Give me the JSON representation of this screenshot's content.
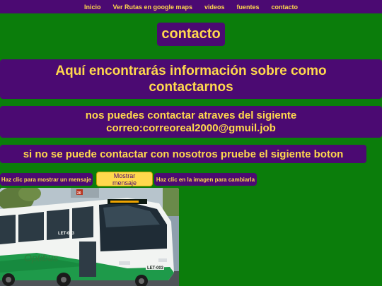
{
  "nav": {
    "items": [
      "Inicio",
      "Ver Rutas en google maps",
      "videos",
      "fuentes",
      "contacto"
    ]
  },
  "page": {
    "title": "contacto",
    "info": "Aquí encontrarás información sobre como contactarnos",
    "contact_line1": "nos puedes contactar atraves del sigiente",
    "contact_line2": "correo:correoreal2000@gmuil.job",
    "fallback": "si no se puede contactar con nosotros pruebe el sigiente boton"
  },
  "controls": {
    "message_label": "Haz clic para mostrar un mensaje",
    "message_button": "Mostrar mensaje",
    "image_label": "Haz clic en la imagen para cambiarla"
  },
  "bus": {
    "brand": "Optibus",
    "unit_id": "LET-003",
    "plate_badge": "LET-003",
    "route_number": "20"
  },
  "colors": {
    "background": "#0b7d0b",
    "panel": "#4b0a72",
    "text": "#ffd84d"
  }
}
